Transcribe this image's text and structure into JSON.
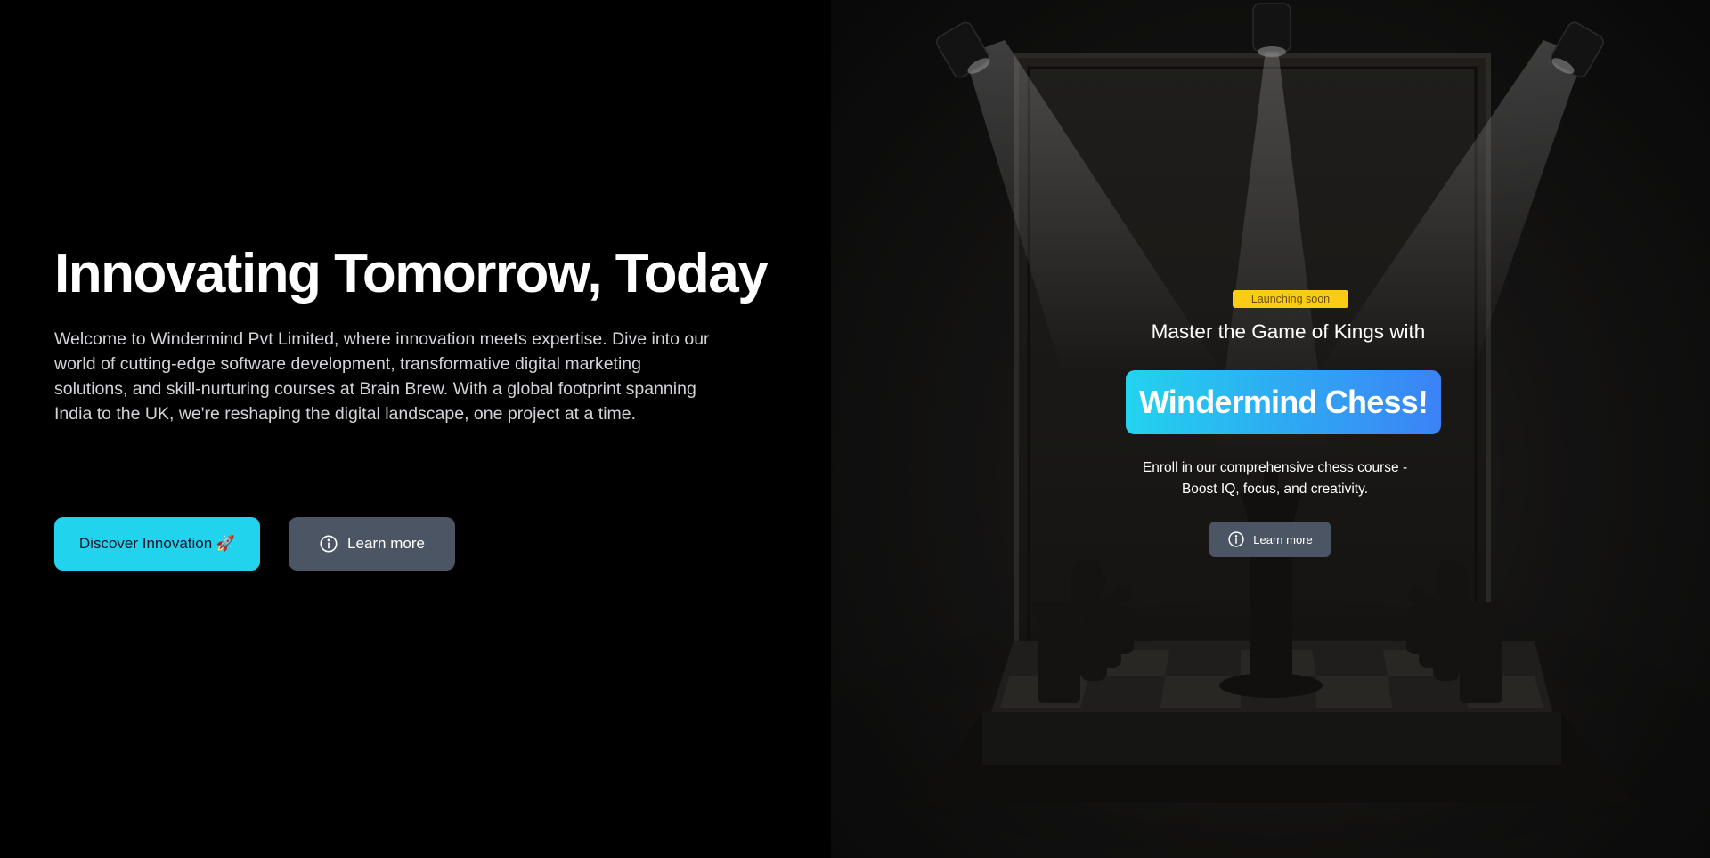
{
  "hero": {
    "title": "Innovating Tomorrow, Today",
    "description": "Welcome to Windermind Pvt Limited, where innovation meets expertise. Dive into our world of cutting-edge software development, transformative digital marketing solutions, and skill-nurturing courses at Brain Brew. With a global footprint spanning India to the UK, we're reshaping the digital landscape, one project at a time.",
    "primary_button": "Discover Innovation 🚀",
    "secondary_button": "Learn more"
  },
  "promo": {
    "badge": "Launching soon",
    "heading": "Master the Game of Kings with",
    "brand": "Windermind Chess!",
    "description_line1": "Enroll in our comprehensive chess course -",
    "description_line2": "Boost IQ, focus, and creativity.",
    "button": "Learn more"
  },
  "colors": {
    "primary_button_bg": "#22d3ee",
    "secondary_button_bg": "#4b5563",
    "badge_bg": "#facc15",
    "brand_gradient_start": "#22d3ee",
    "brand_gradient_end": "#3b82f6"
  },
  "icons": {
    "learn_more": "info-circle-icon"
  }
}
